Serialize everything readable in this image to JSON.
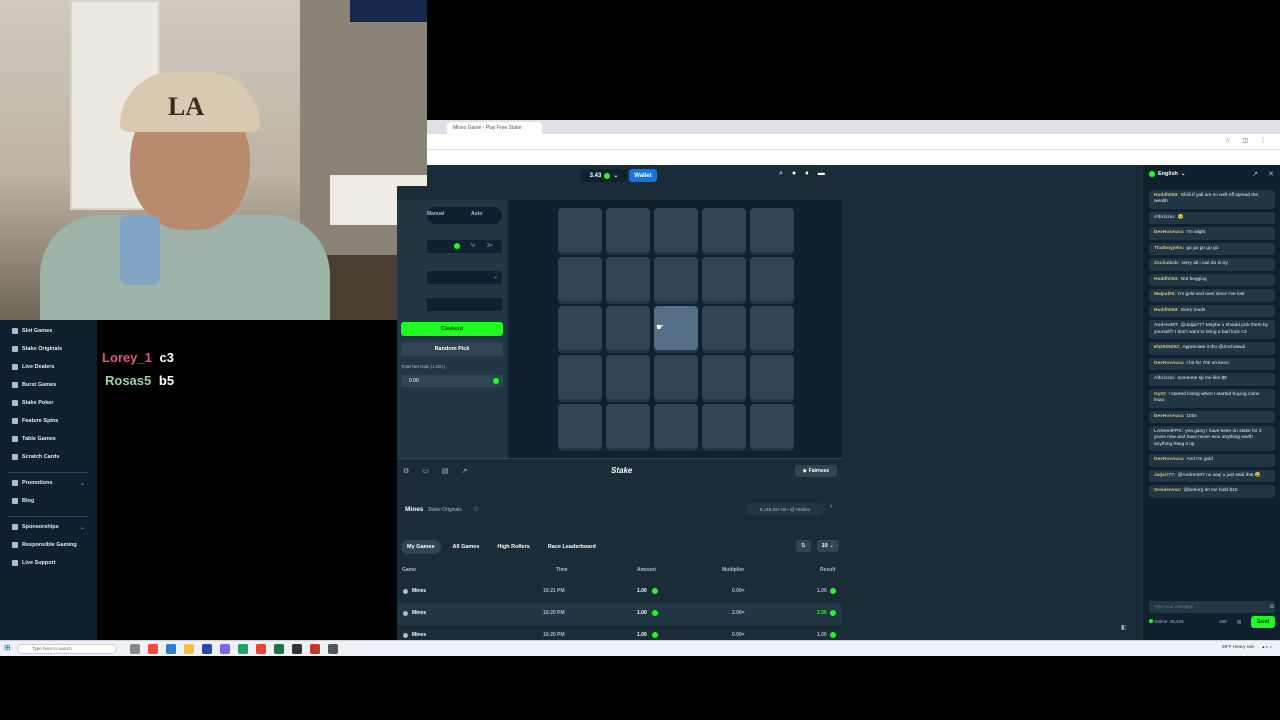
{
  "overlay": {
    "lines": [
      {
        "name": "Lorey_1",
        "code": "c3",
        "color": "#e2567a"
      },
      {
        "name": "Rosas5",
        "code": "b5",
        "color": "#9ed3a1"
      }
    ]
  },
  "webcam": {
    "cap_text": "LA"
  },
  "browser": {
    "tab_title": "Mines Game - Play Free Stake"
  },
  "sidebar": {
    "items": [
      "Slot Games",
      "Stake Originals",
      "Live Dealers",
      "Burst Games",
      "Stake Poker",
      "Feature Spins",
      "Table Games",
      "Scratch Cards"
    ],
    "items2": [
      "Promotions",
      "Blog"
    ],
    "items3": [
      "Sponsorships",
      "Responsible Gaming",
      "Live Support"
    ]
  },
  "header": {
    "balance": "3.43",
    "wallet_label": "Wallet"
  },
  "controls": {
    "mode_manual": "Manual",
    "mode_auto": "Auto",
    "half": "½",
    "double": "2×",
    "cashout_label": "Cashout",
    "random_pick_label": "Random Pick",
    "net_gain_label": "Total Net Gain (1.00×)",
    "net_gain_value": "0.00"
  },
  "gamebar": {
    "logo": "Stake",
    "fairness_label": "Fairness"
  },
  "info": {
    "title": "Mines",
    "subtitle": "Stake Originals",
    "edge_badge": "5,148,297.00+ @ Hidden"
  },
  "bets": {
    "tabs": [
      "My Games",
      "All Games",
      "High Rollers",
      "Race Leaderboard"
    ],
    "rows_per_page": "10",
    "columns": [
      "Game",
      "Time",
      "Amount",
      "Multiplier",
      "Result"
    ],
    "rows": [
      {
        "game": "Mines",
        "time": "10:21 PM",
        "amount": "1.00",
        "multiplier": "0.00×",
        "result": "1.00",
        "win": false
      },
      {
        "game": "Mines",
        "time": "10:20 PM",
        "amount": "1.00",
        "multiplier": "2.06×",
        "result": "2.06",
        "win": true
      },
      {
        "game": "Mines",
        "time": "10:20 PM",
        "amount": "1.00",
        "multiplier": "0.00×",
        "result": "1.00",
        "win": false
      }
    ]
  },
  "chat": {
    "language": "English",
    "messages": [
      {
        "user": "Huddh053:",
        "text": "Shiiii if yall are so well off spread the wealth",
        "vip": true
      },
      {
        "user": "Albrizzio:",
        "text": "🥺",
        "vip": false
      },
      {
        "user": "DevHosAura:",
        "text": "I'm alight",
        "vip": true
      },
      {
        "user": "Thatboyjohn:",
        "text": "go go go go go",
        "vip": true
      },
      {
        "user": "Zochatack:",
        "text": "sorry all i can do is try",
        "vip": true
      },
      {
        "user": "Huddh053:",
        "text": "Not begging",
        "vip": true
      },
      {
        "user": "Malpal25:",
        "text": "I'm gold and over since I've lost",
        "vip": true
      },
      {
        "user": "Huddh053:",
        "text": "Sorry mods",
        "vip": true
      },
      {
        "user": "AndreoMT:",
        "text": "@Jaljai777 Maybe u should pick them by yourself? I don't want to bring a bad luck <3",
        "vip": false
      },
      {
        "user": "Eb2929292:",
        "text": "Appreciate it tho @Zochatack",
        "vip": true
      },
      {
        "user": "DevHosAura:",
        "text": "I hit for 700 on keno",
        "vip": true
      },
      {
        "user": "Albrizzio:",
        "text": "someone tip me like $5",
        "vip": false
      },
      {
        "user": "Gynt:",
        "text": "I started losing when I started buying coins lmao",
        "vip": true
      },
      {
        "user": "DevHosAura:",
        "text": "100x",
        "vip": true
      },
      {
        "user": "LANeedFPS:",
        "text": "yea gang I have been on stake for 3 years now and have never won anything worth anything hang it up",
        "vip": false
      },
      {
        "user": "DevHosAura:",
        "text": "And I'm gold",
        "vip": true
      },
      {
        "user": "Jaljai777:",
        "text": "@AndreoMT no way u just said that 😂",
        "vip": true
      },
      {
        "user": "Sroulenvoz:",
        "text": "@berlorg let me hold $10",
        "vip": true
      }
    ],
    "input_placeholder": "Type your message",
    "online": "Online: 15,425",
    "char_count": "160",
    "send_label": "Send"
  },
  "taskbar": {
    "search_placeholder": "Type here to search",
    "weather": "59°F Heavy rain"
  },
  "colors": {
    "accent_green": "#1fff20",
    "wallet_blue": "#1475e1",
    "bg_dark": "#0f212e",
    "bg_mid": "#1a2c38",
    "tile": "#2f4553"
  }
}
